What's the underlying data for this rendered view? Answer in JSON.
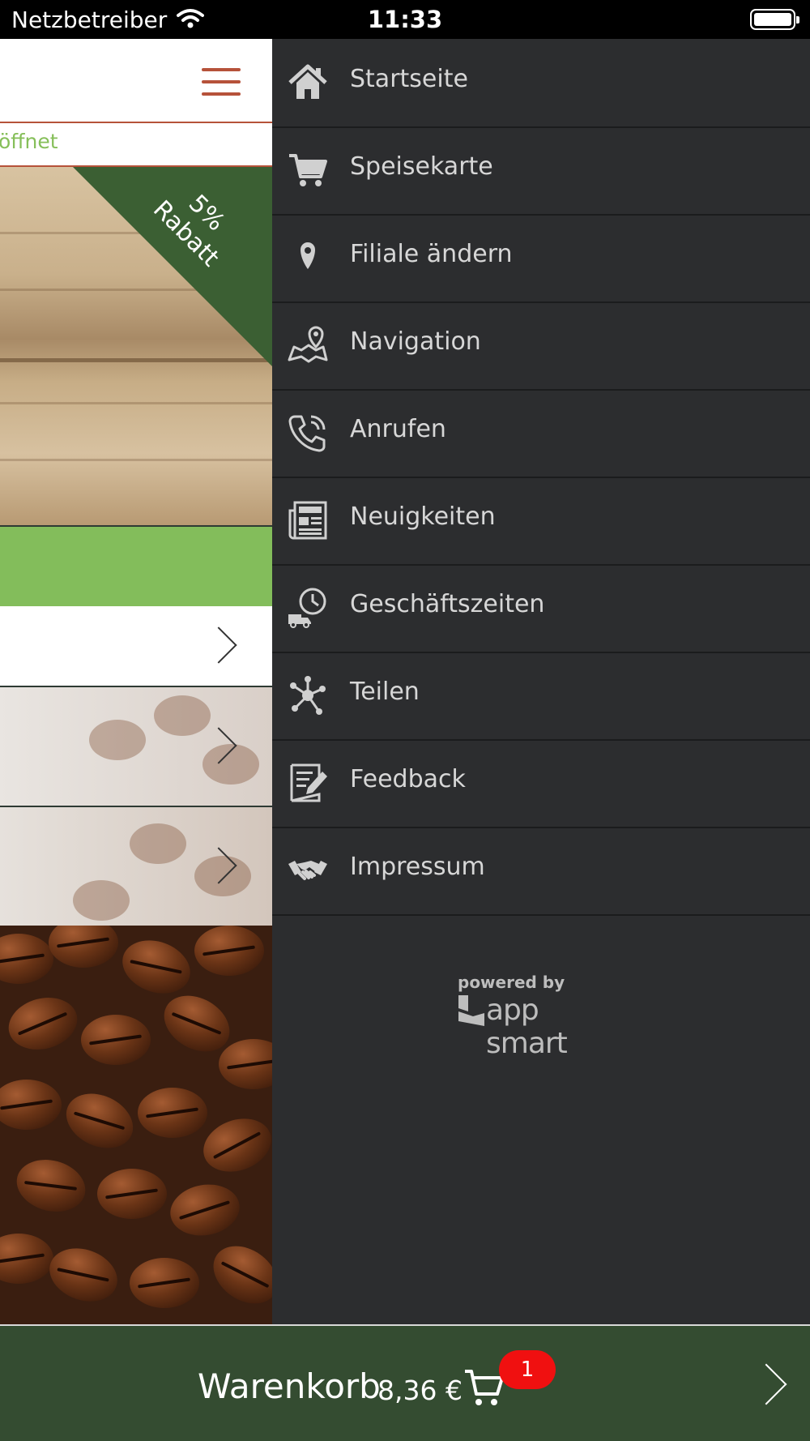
{
  "status_bar": {
    "carrier": "Netzbetreiber",
    "time": "11:33"
  },
  "app": {
    "open_status": "öffnet",
    "promo_ribbon": {
      "line1": "5%",
      "line2": "Rabatt"
    }
  },
  "menu": {
    "items": [
      {
        "label": "Startseite",
        "icon": "home-icon"
      },
      {
        "label": "Speisekarte",
        "icon": "cart-icon"
      },
      {
        "label": "Filiale ändern",
        "icon": "location-pin-icon"
      },
      {
        "label": "Navigation",
        "icon": "map-icon"
      },
      {
        "label": "Anrufen",
        "icon": "phone-icon"
      },
      {
        "label": "Neuigkeiten",
        "icon": "newspaper-icon"
      },
      {
        "label": "Geschäftszeiten",
        "icon": "delivery-clock-icon"
      },
      {
        "label": "Teilen",
        "icon": "share-icon"
      },
      {
        "label": "Feedback",
        "icon": "feedback-icon"
      },
      {
        "label": "Impressum",
        "icon": "handshake-icon"
      }
    ],
    "powered_by": "powered by",
    "brand": "app smart"
  },
  "cart": {
    "label": "Warenkorb",
    "total": "8,36 €",
    "count": "1"
  },
  "colors": {
    "accent_red": "#b6523a",
    "green_bar": "#83bd5b",
    "dark_green": "#344c31",
    "drawer_bg": "#2c2d2f",
    "badge_red": "#f01010"
  }
}
